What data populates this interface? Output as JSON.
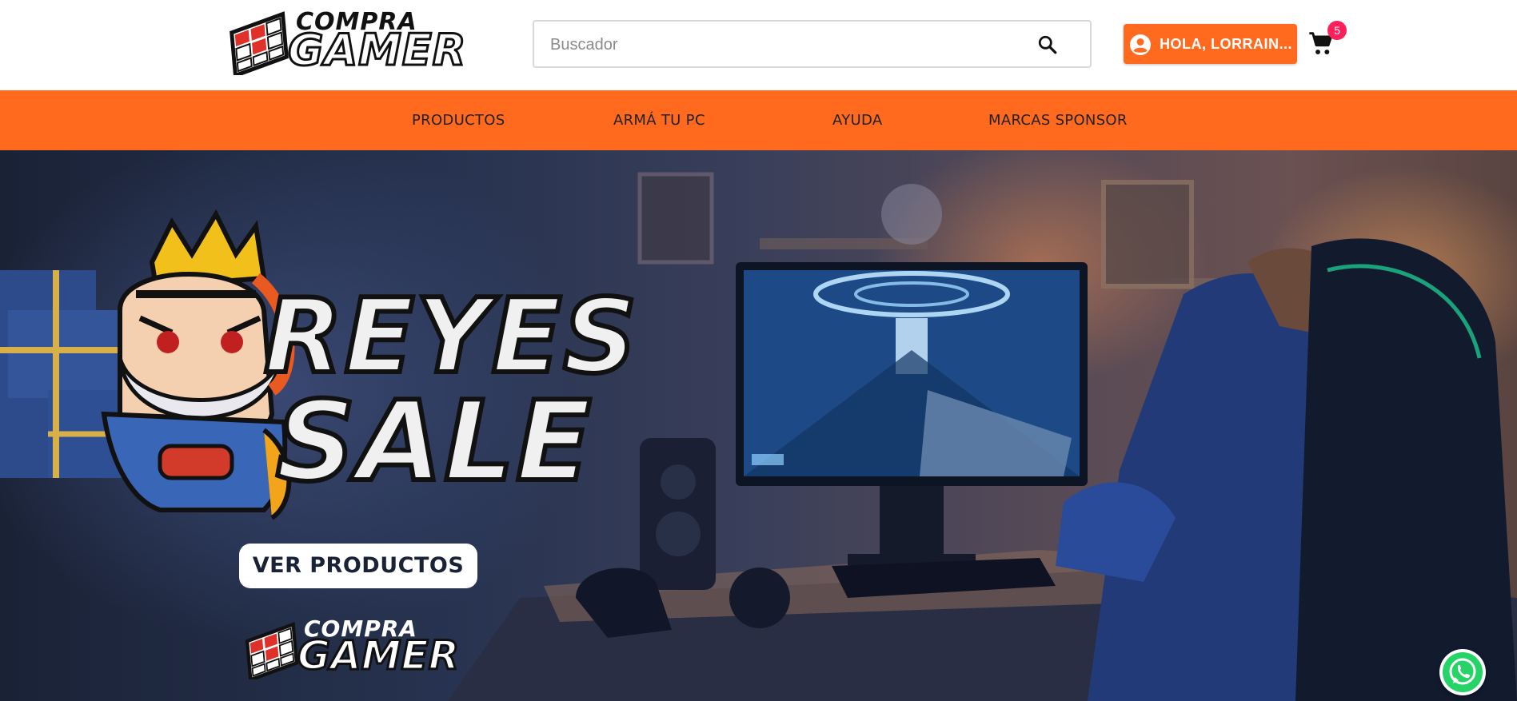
{
  "header": {
    "logo_top": "COMPRA",
    "logo_bottom": "GAMER",
    "search_placeholder": "Buscador",
    "user_label": "HOLA, LORRAIN...",
    "cart_count": "5"
  },
  "nav": {
    "items": [
      {
        "label": "PRODUCTOS"
      },
      {
        "label": "ARMÁ TU PC"
      },
      {
        "label": "AYUDA"
      },
      {
        "label": "MARCAS SPONSOR"
      }
    ]
  },
  "hero": {
    "title_line1": "REYES",
    "title_line2": "SALE",
    "cta_label": "VER PRODUCTOS",
    "logo_top": "COMPRA",
    "logo_bottom": "GAMER"
  },
  "colors": {
    "accent": "#ff6a1f",
    "badge": "#ff1f5a",
    "whatsapp": "#25d366"
  },
  "icons": [
    "search-icon",
    "user-icon",
    "cart-icon",
    "whatsapp-icon"
  ]
}
